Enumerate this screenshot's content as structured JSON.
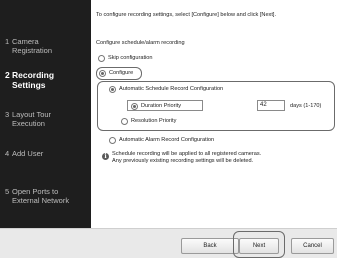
{
  "sidebar": {
    "items": [
      {
        "num": "1",
        "label_line1": "Camera",
        "label_line2": "Registration",
        "active": false
      },
      {
        "num": "2",
        "label_line1": "Recording",
        "label_line2": "Settings",
        "active": true
      },
      {
        "num": "3",
        "label_line1": "Layout Tour",
        "label_line2": "Execution",
        "active": false
      },
      {
        "num": "4",
        "label_line1": "Add User",
        "label_line2": "",
        "active": false
      },
      {
        "num": "5",
        "label_line1": "Open Ports to",
        "label_line2": "External Network",
        "active": false
      }
    ]
  },
  "main": {
    "instruction": "To configure recording settings, select [Configure] below and click [Next].",
    "section_label": "Configure schedule/alarm recording",
    "skip_label": "Skip configuration",
    "configure_label": "Configure",
    "auto_schedule_label": "Automatic Schedule Record Configuration",
    "duration_label": "Duration Priority",
    "duration_value": "42",
    "days_label": "days (1-170)",
    "resolution_label": "Resolution Priority",
    "auto_alarm_label": "Automatic Alarm Record Configuration",
    "info_icon_glyph": "i",
    "note_line1": "Schedule recording will be applied to all registered cameras.",
    "note_line2": "Any previously existing recording settings will be deleted."
  },
  "footer": {
    "back_label": "Back",
    "next_label": "Next",
    "cancel_label": "Cancel"
  },
  "colors": {
    "sidebar_bg": "#1e1e1e",
    "highlight_outline": "#6b6b6b"
  }
}
